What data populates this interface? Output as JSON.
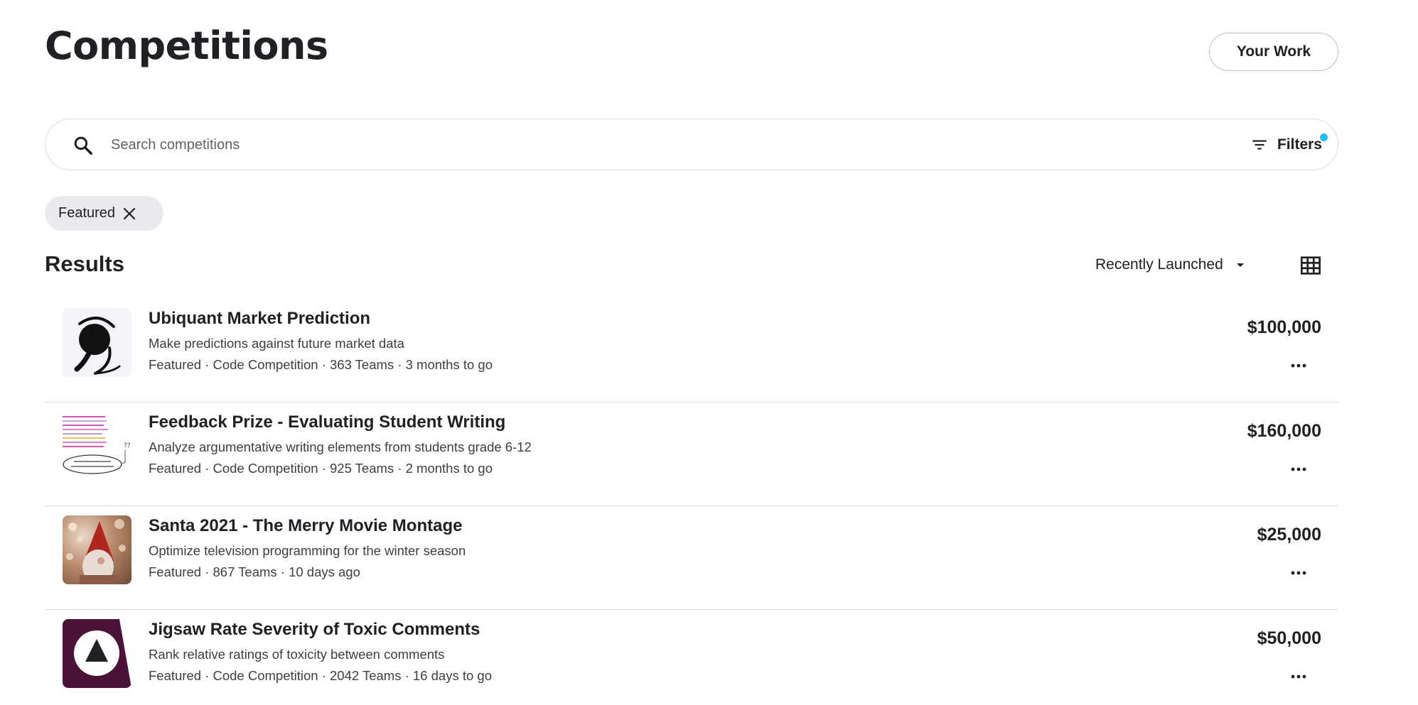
{
  "header": {
    "title": "Competitions",
    "your_work_label": "Your Work"
  },
  "search": {
    "icon": "search-icon",
    "placeholder": "Search competitions",
    "value": "",
    "filters_label": "Filters",
    "filters_icon": "filter-list-icon",
    "filters_indicator_color": "#20beff"
  },
  "active_filters": [
    {
      "label": "Featured",
      "icon": "close-icon"
    }
  ],
  "results": {
    "heading": "Results",
    "sort_label": "Recently Launched",
    "sort_icon": "caret-down-icon",
    "view_toggle_icon": "grid-view-icon"
  },
  "competitions": [
    {
      "title": "Ubiquant Market Prediction",
      "description": "Make predictions against future market data",
      "meta": "Featured · Code Competition · 363 Teams · 3 months to go",
      "prize": "$100,000",
      "thumb_icon": "ubiquant-logo-icon"
    },
    {
      "title": "Feedback Prize - Evaluating Student Writing",
      "description": "Analyze argumentative writing elements from students grade 6-12",
      "meta": "Featured · Code Competition · 925 Teams · 2 months to go",
      "prize": "$160,000",
      "thumb_icon": "feedback-prize-thumbnail"
    },
    {
      "title": "Santa 2021 - The Merry Movie Montage",
      "description": "Optimize television programming for the winter season",
      "meta": "Featured · 867 Teams · 10 days ago",
      "prize": "$25,000",
      "thumb_icon": "santa-gnome-thumbnail"
    },
    {
      "title": "Jigsaw Rate Severity of Toxic Comments",
      "description": "Rank relative ratings of toxicity between comments",
      "meta": "Featured · Code Competition · 2042 Teams · 16 days to go",
      "prize": "$50,000",
      "thumb_icon": "jigsaw-logo-icon"
    }
  ],
  "colors": {
    "accent_blue": "#20beff",
    "chip_bg": "#e8eaed",
    "divider": "#dadce0",
    "text_primary": "#202124",
    "text_secondary": "#3c4043",
    "jigsaw_brand": "#4a1236"
  }
}
